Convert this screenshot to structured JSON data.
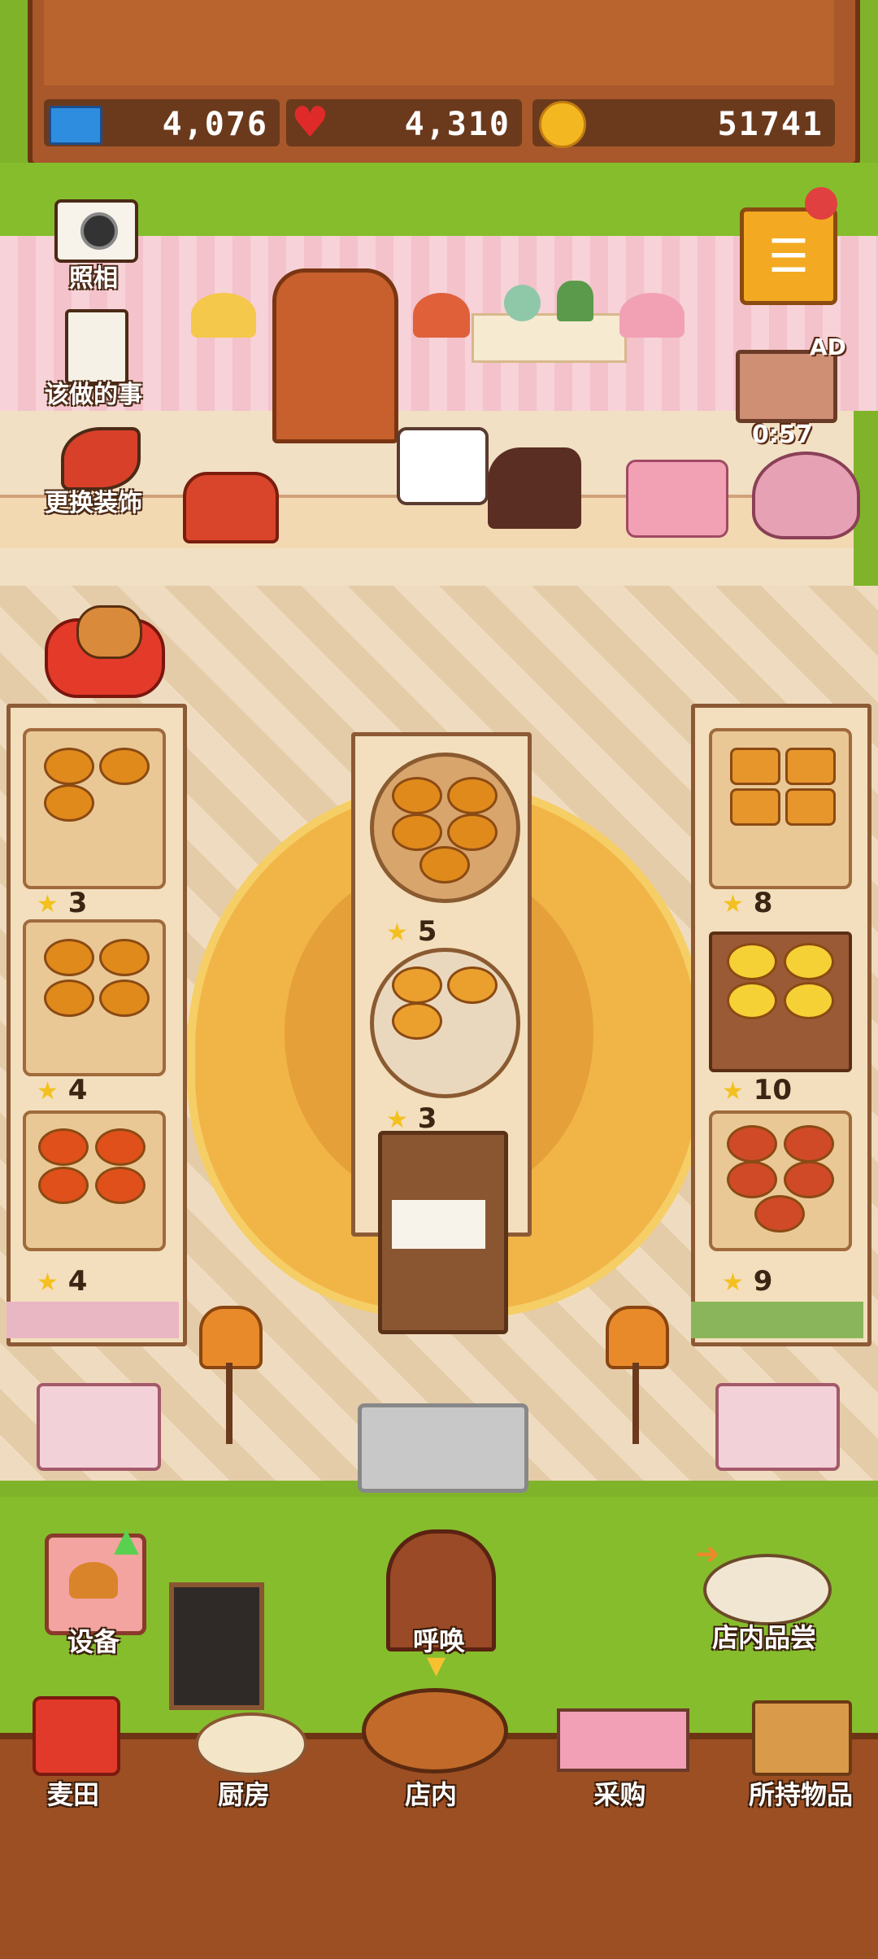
{
  "header": {
    "tickets": "4,076",
    "hearts": "4,310",
    "coins": "51741"
  },
  "side_menu": {
    "photo_label": "照相",
    "todo_label": "该做的事",
    "decor_label": "更换装饰"
  },
  "tv": {
    "ad_label": "AD",
    "timer": "0:57"
  },
  "shelves": {
    "left": [
      "3",
      "4",
      "4"
    ],
    "center": [
      "5",
      "3"
    ],
    "right": [
      "8",
      "10",
      "9"
    ]
  },
  "actions": {
    "equipment_label": "设备",
    "call_label": "呼唤",
    "tasting_label": "店内品尝"
  },
  "nav": {
    "field": "麦田",
    "kitchen": "厨房",
    "shop": "店内",
    "purchase": "采购",
    "inventory": "所持物品"
  },
  "colors": {
    "wood": "#a8582a",
    "grass": "#86bd2c",
    "wall_pink": "#f7d2d8",
    "rug": "#f1b547"
  }
}
